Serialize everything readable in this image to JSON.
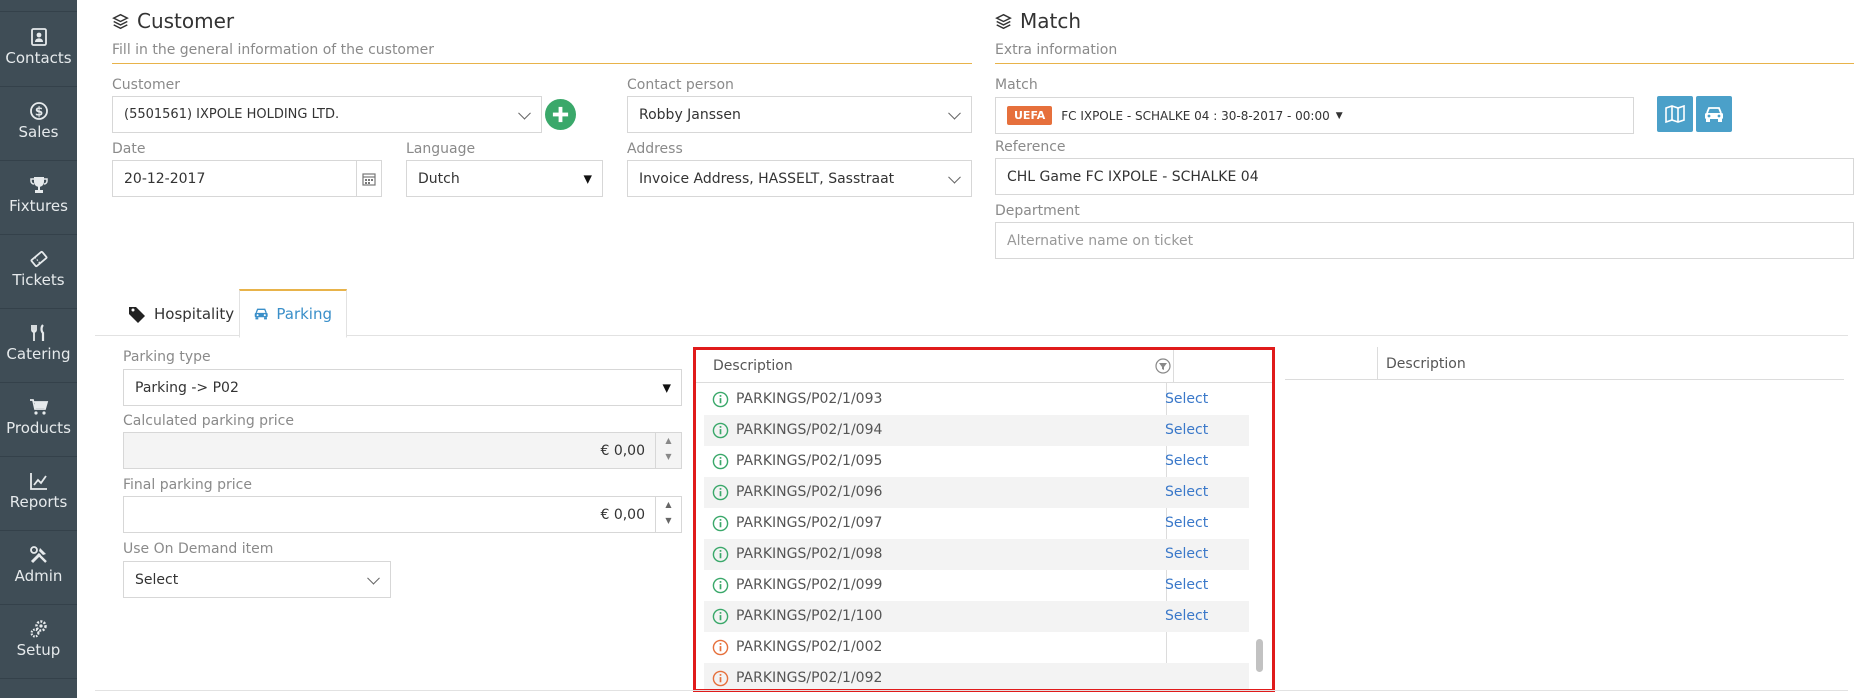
{
  "sidebar": {
    "items": [
      {
        "label": "Contacts",
        "icon": "contacts-icon"
      },
      {
        "label": "Sales",
        "icon": "dollar-icon"
      },
      {
        "label": "Fixtures",
        "icon": "trophy-icon"
      },
      {
        "label": "Tickets",
        "icon": "ticket-icon"
      },
      {
        "label": "Catering",
        "icon": "cutlery-icon"
      },
      {
        "label": "Products",
        "icon": "cart-icon"
      },
      {
        "label": "Reports",
        "icon": "line-chart-icon"
      },
      {
        "label": "Admin",
        "icon": "tools-icon"
      },
      {
        "label": "Setup",
        "icon": "gears-icon"
      }
    ]
  },
  "customer_panel": {
    "title": "Customer",
    "subtitle": "Fill in the general information of the customer",
    "customer_label": "Customer",
    "customer_value": "(5501561) IXPOLE HOLDING LTD.",
    "contact_label": "Contact person",
    "contact_value": "Robby Janssen",
    "date_label": "Date",
    "date_value": "20-12-2017",
    "language_label": "Language",
    "language_value": "Dutch",
    "address_label": "Address",
    "address_value": "Invoice Address, HASSELT, Sasstraat"
  },
  "match_panel": {
    "title": "Match",
    "subtitle": "Extra information",
    "match_label": "Match",
    "match_badge": "UEFA",
    "match_value": "FC IXPOLE - SCHALKE 04 : 30-8-2017 - 00:00",
    "reference_label": "Reference",
    "reference_value": "CHL Game FC IXPOLE - SCHALKE 04",
    "department_label": "Department",
    "department_placeholder": "Alternative name on ticket"
  },
  "tabs": [
    {
      "label": "Hospitality",
      "active": false
    },
    {
      "label": "Parking",
      "active": true
    }
  ],
  "parking": {
    "type_label": "Parking type",
    "type_value": "Parking -> P02",
    "calc_label": "Calculated parking price",
    "calc_value": "€ 0,00",
    "final_label": "Final parking price",
    "final_value": "€ 0,00",
    "ondemand_label": "Use On Demand item",
    "ondemand_value": "Select"
  },
  "grid": {
    "header": "Description",
    "select_label": "Select",
    "rows": [
      {
        "text": "PARKINGS/P02/1/093",
        "status": "available"
      },
      {
        "text": "PARKINGS/P02/1/094",
        "status": "available"
      },
      {
        "text": "PARKINGS/P02/1/095",
        "status": "available"
      },
      {
        "text": "PARKINGS/P02/1/096",
        "status": "available"
      },
      {
        "text": "PARKINGS/P02/1/097",
        "status": "available"
      },
      {
        "text": "PARKINGS/P02/1/098",
        "status": "available"
      },
      {
        "text": "PARKINGS/P02/1/099",
        "status": "available"
      },
      {
        "text": "PARKINGS/P02/1/100",
        "status": "available"
      },
      {
        "text": "PARKINGS/P02/1/002",
        "status": "unavailable"
      },
      {
        "text": "PARKINGS/P02/1/092",
        "status": "unavailable"
      }
    ]
  },
  "right_grid": {
    "header": "Description"
  },
  "colors": {
    "sidebar_bg": "#3f4d56",
    "accent": "#e8b34a",
    "link": "#3a78c9",
    "available": "#3aa86a",
    "unavailable": "#e6703c",
    "highlight": "#e01b1b"
  }
}
